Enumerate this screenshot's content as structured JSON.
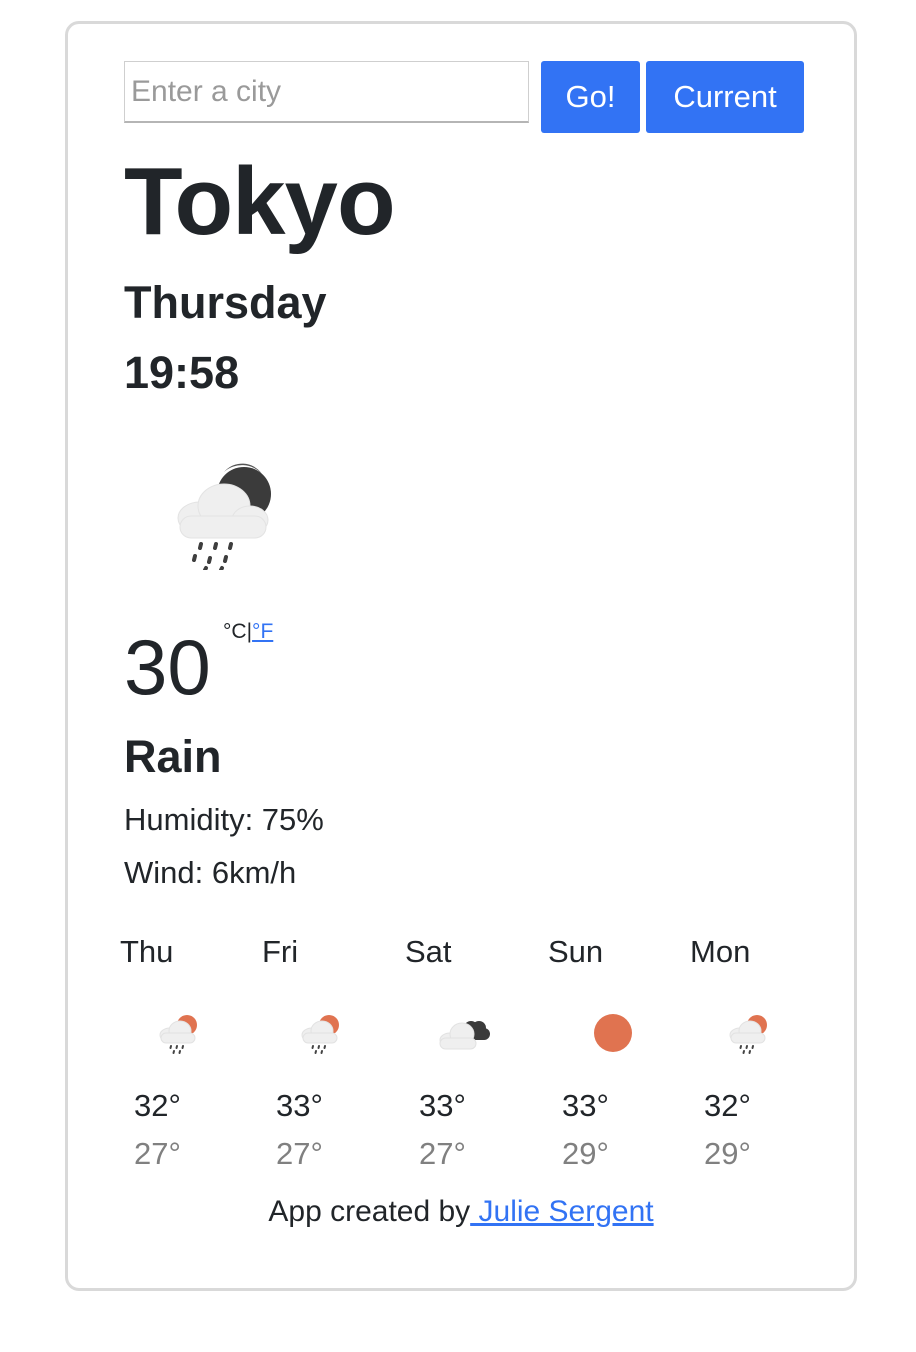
{
  "search": {
    "placeholder": "Enter a city",
    "value": "",
    "go_label": "Go!",
    "current_label": "Current"
  },
  "weather": {
    "city": "Tokyo",
    "day": "Thursday",
    "time": "19:58",
    "icon": "night-rain-cloud-icon",
    "temperature": "30",
    "unit_celsius": "°C",
    "unit_separator": "|",
    "unit_fahrenheit": "°F",
    "description": "Rain",
    "humidity": "Humidity: 75%",
    "wind": "Wind: 6km/h"
  },
  "forecast": [
    {
      "day": "Thu",
      "icon": "day-rain-cloud-icon",
      "max": "32°",
      "min": "27°"
    },
    {
      "day": "Fri",
      "icon": "day-rain-cloud-icon",
      "max": "33°",
      "min": "27°"
    },
    {
      "day": "Sat",
      "icon": "dark-cloud-icon",
      "max": "33°",
      "min": "27°"
    },
    {
      "day": "Sun",
      "icon": "sun-icon",
      "max": "33°",
      "min": "29°"
    },
    {
      "day": "Mon",
      "icon": "day-rain-cloud-icon",
      "max": "32°",
      "min": "29°"
    }
  ],
  "footer": {
    "prefix": "App created by",
    "author": " Julie Sergent"
  },
  "colors": {
    "accent": "#3273f4",
    "sun": "#e07350",
    "min_temp": "#808080"
  }
}
